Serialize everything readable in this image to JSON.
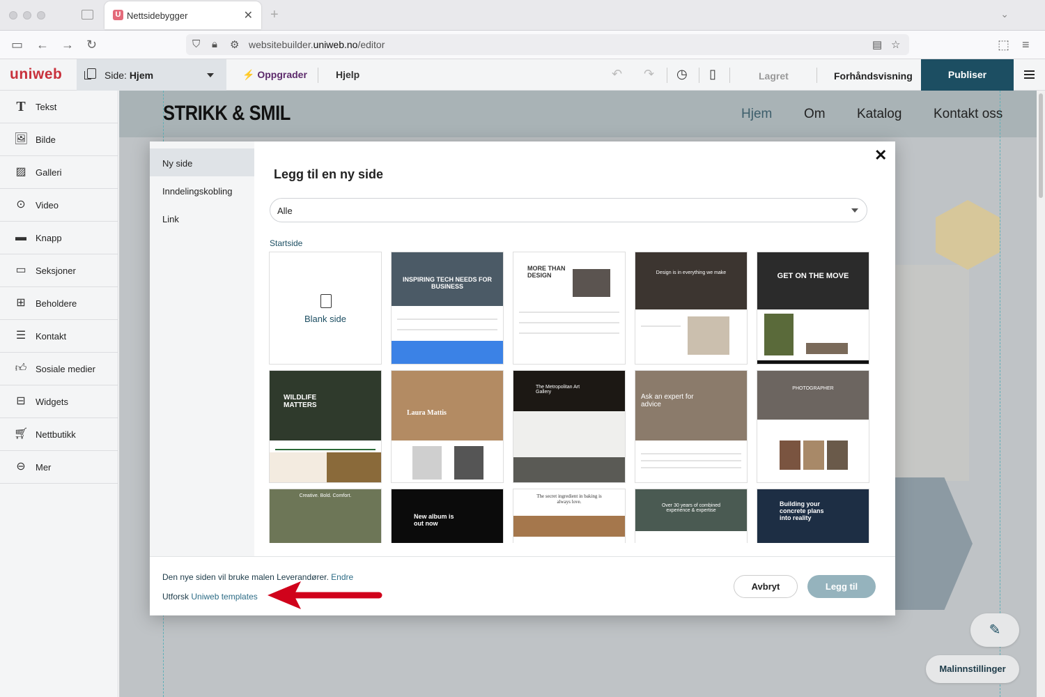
{
  "browser": {
    "tab_title": "Nettsidebygger",
    "tab_favicon": "U",
    "url_prefix": "websitebuilder.",
    "url_domain": "uniweb.no",
    "url_path": "/editor"
  },
  "header": {
    "logo": "uniweb",
    "page_prefix": "Side:",
    "page_name": "Hjem",
    "upgrade": "Oppgrader",
    "help": "Hjelp",
    "saved": "Lagret",
    "preview": "Forhåndsvisning",
    "publish": "Publiser"
  },
  "sidebar": {
    "items": [
      {
        "label": "Tekst",
        "icon": "text-icon"
      },
      {
        "label": "Bilde",
        "icon": "image-icon"
      },
      {
        "label": "Galleri",
        "icon": "gallery-icon"
      },
      {
        "label": "Video",
        "icon": "video-icon"
      },
      {
        "label": "Knapp",
        "icon": "button-icon"
      },
      {
        "label": "Seksjoner",
        "icon": "sections-icon"
      },
      {
        "label": "Beholdere",
        "icon": "containers-icon"
      },
      {
        "label": "Kontakt",
        "icon": "contact-icon"
      },
      {
        "label": "Sosiale medier",
        "icon": "thumbs-up-icon"
      },
      {
        "label": "Widgets",
        "icon": "widgets-icon"
      },
      {
        "label": "Nettbutikk",
        "icon": "cart-icon"
      },
      {
        "label": "Mer",
        "icon": "more-icon"
      }
    ]
  },
  "site": {
    "logo": "STRIKK & SMIL",
    "nav": [
      "Hjem",
      "Om",
      "Katalog",
      "Kontakt oss"
    ]
  },
  "modal": {
    "tabs": [
      "Ny side",
      "Inndelingskobling",
      "Link"
    ],
    "title": "Legg til en ny side",
    "filter_value": "Alle",
    "category": "Startside",
    "blank_label": "Blank side",
    "templates": [
      {
        "caption": "INSPIRING TECH NEEDS FOR BUSINESS"
      },
      {
        "caption": "MORE THAN DESIGN"
      },
      {
        "caption": "Design is in everything we make"
      },
      {
        "caption": "GET ON THE MOVE"
      },
      {
        "caption": "WILDLIFE MATTERS"
      },
      {
        "caption": "Laura Mattis"
      },
      {
        "caption": "The Metropolitan Art Gallery"
      },
      {
        "caption": "Ask an expert for advice"
      },
      {
        "caption": "PHOTOGRAPHER"
      },
      {
        "caption": "Creative. Bold. Comfort."
      },
      {
        "caption": "New album is out now"
      },
      {
        "caption": "The secret ingredient in baking is always love."
      },
      {
        "caption": "Over 30 years of combined experience & expertise"
      },
      {
        "caption": "Building your concrete plans into reality"
      }
    ],
    "footer_text": "Den nye siden vil bruke malen Leverandører.",
    "footer_change": "Endre",
    "explore_prefix": "Utforsk",
    "explore_link": "Uniweb templates",
    "cancel": "Avbryt",
    "add": "Legg til"
  },
  "floating": {
    "template_settings": "Malinnstillinger"
  },
  "colors": {
    "brand": "#c8313c",
    "publish": "#1c4e62",
    "add_button": "#95b3bd"
  }
}
